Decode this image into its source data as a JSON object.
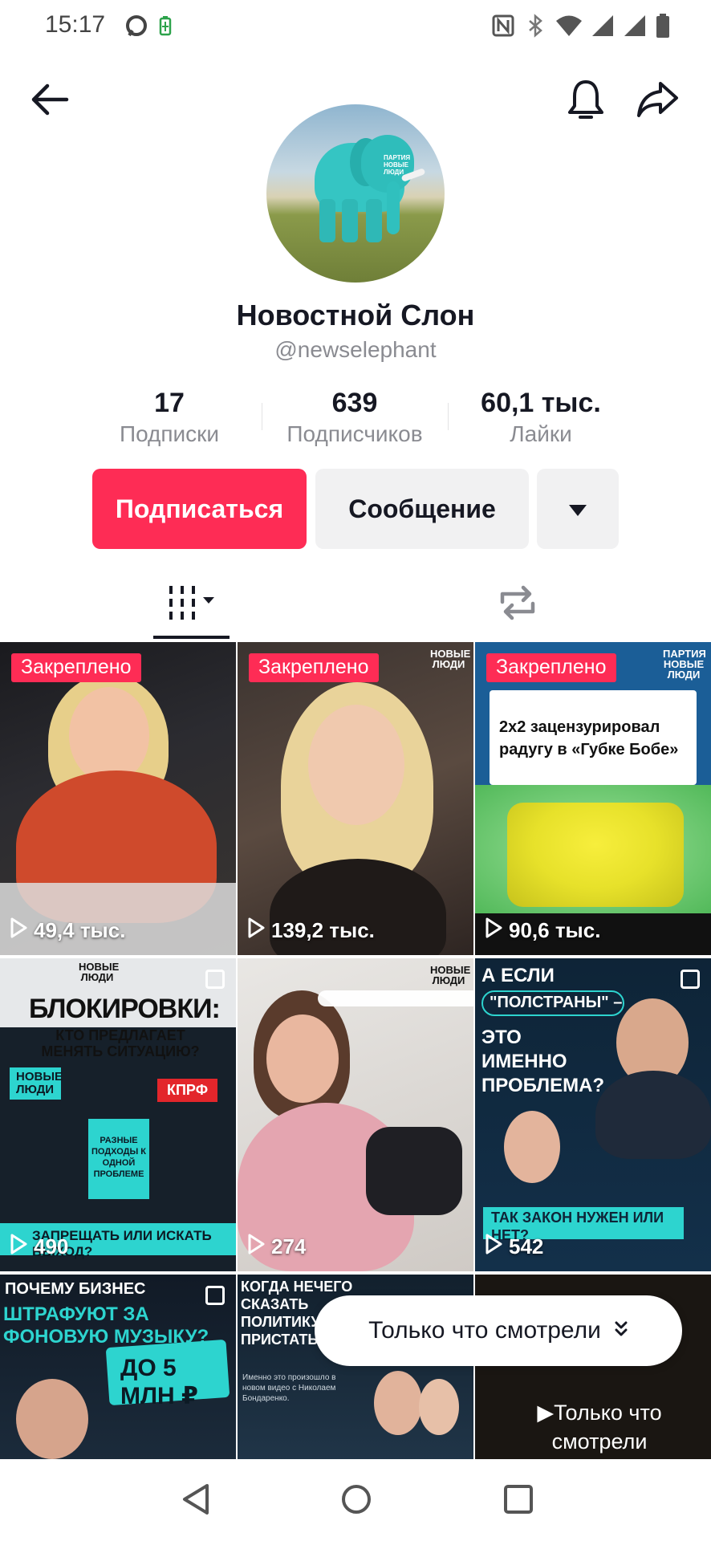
{
  "status_bar": {
    "time": "15:17",
    "icons": [
      "chat-bubble-icon",
      "battery-saver-icon",
      "nfc-icon",
      "bluetooth-icon",
      "wifi-icon",
      "signal-icon",
      "signal-icon",
      "battery-icon"
    ]
  },
  "header": {
    "back_icon": "arrow-left-icon",
    "bell_icon": "bell-icon",
    "share_icon": "share-arrow-icon"
  },
  "profile": {
    "name": "Новостной Слон",
    "handle": "@newselephant",
    "avatar_text": "ПАРТИЯ НОВЫЕ ЛЮДИ"
  },
  "stats": [
    {
      "value": "17",
      "label": "Подписки"
    },
    {
      "value": "639",
      "label": "Подписчиков"
    },
    {
      "value": "60,1 тыс.",
      "label": "Лайки"
    }
  ],
  "actions": {
    "follow": "Подписаться",
    "message": "Сообщение",
    "more_icon": "caret-down-icon"
  },
  "tabs": {
    "videos_icon": "grid-columns-icon",
    "reposts_icon": "repost-icon"
  },
  "videos": [
    {
      "pinned": "Закреплено",
      "views": "49,4 тыс."
    },
    {
      "pinned": "Закреплено",
      "views": "139,2 тыс.",
      "badge": "НОВЫЕ ЛЮДИ"
    },
    {
      "pinned": "Закреплено",
      "views": "90,6 тыс.",
      "badge": "ПАРТИЯ НОВЫЕ ЛЮДИ",
      "card_text": "2х2 зацензурировал радугу в «Губке Бобе»"
    },
    {
      "views": "490",
      "badge": "НОВЫЕ ЛЮДИ",
      "title": "БЛОКИРОВКИ:",
      "subtitle": "КТО ПРЕДЛАГАЕТ МЕНЯТЬ СИТУАЦИЮ?",
      "left_label": "НОВЫЕ ЛЮДИ",
      "right_label": "КПРФ",
      "middle": "РАЗНЫЕ ПОДХОДЫ К ОДНОЙ ПРОБЛЕМЕ",
      "bottom": "ЗАПРЕЩАТЬ ИЛИ ИСКАТЬ ВЫХОД?"
    },
    {
      "views": "274",
      "badge": "НОВЫЕ ЛЮДИ"
    },
    {
      "views": "542",
      "title": "А ЕСЛИ",
      "pill": "\"ПОЛСТРАНЫ\" –",
      "title2": "ЭТО ИМЕННО ПРОБЛЕМА?",
      "bottom": "ТАК ЗАКОН НУЖЕН ИЛИ НЕТ?"
    },
    {
      "title": "ПОЧЕМУ БИЗНЕС",
      "title2": "ШТРАФУЮТ ЗА ФОНОВУЮ МУЗЫКУ?",
      "sticker": "ДО 5 МЛН ₽"
    },
    {
      "title": "КОГДА НЕЧЕГО СКАЗАТЬ ПОЛИТИКУ – ПРИСТАТЬ К ЕЕ",
      "text": "Именно это произошло в новом видео с Николаем Бондаренко."
    },
    {
      "label": "Только что смотрели"
    }
  ],
  "toast": {
    "text": "Только что смотрели",
    "icon": "double-chevron-down-icon"
  },
  "nav_bar": {
    "back_icon": "nav-back-icon",
    "home_icon": "nav-home-icon",
    "recents_icon": "nav-recents-icon"
  }
}
